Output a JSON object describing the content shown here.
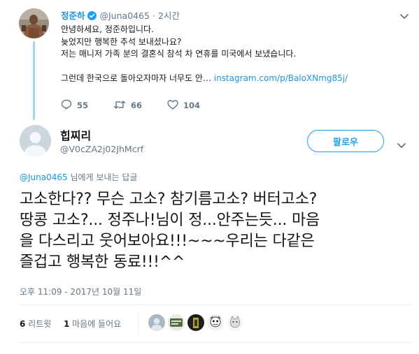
{
  "parent_tweet": {
    "author_name": "정준하",
    "handle": "@Juna0465",
    "separator": "·",
    "time": "2시간",
    "body_lines": [
      "안녕하세요, 정준하입니다.",
      "늦었지만 행복한 추석 보내셨나요?",
      "저는 매니저 가족 분의 결혼식 참석 차 연휴를 미국에서 보냈습니다."
    ],
    "body_last_text": "그런데 한국으로 돌아오자마자 너무도 안… ",
    "link_text": "instagram.com/p/BaloXNmg85j/",
    "replies": "55",
    "retweets": "66",
    "likes": "104",
    "icons": [
      "reply-icon",
      "retweet-icon",
      "like-icon",
      "verified-badge-icon",
      "chevron-down-icon"
    ]
  },
  "main_tweet": {
    "author_name": "힙찌리",
    "handle": "@V0cZA2j02JhMcrf",
    "follow_label": "팔로우",
    "reply_mention": "@Juna0465",
    "reply_suffix": " 님에게 보내는 답글",
    "text_lines": [
      "고소한다?? 무슨 고소? 참기름고소? 버터고소?",
      "땅콩 고소?... 정주나!님이 정...안주는듯... 마음",
      "을 다스리고 웃어보아요!!!~~~우리는 다같은",
      "즐겁고 행복한 동료!!!^^"
    ],
    "timestamp": "오후 11:09 - 2017년 10월 11일",
    "retweet_count": "6",
    "retweet_label": " 리트윗",
    "like_count": "1",
    "like_label": " 마음에 들어요"
  },
  "colors": {
    "accent": "#1da1f2",
    "link": "#1b95e0",
    "secondary_text": "#657786",
    "thread_line": "#a6d2ee",
    "divider": "#e6ecf0"
  }
}
